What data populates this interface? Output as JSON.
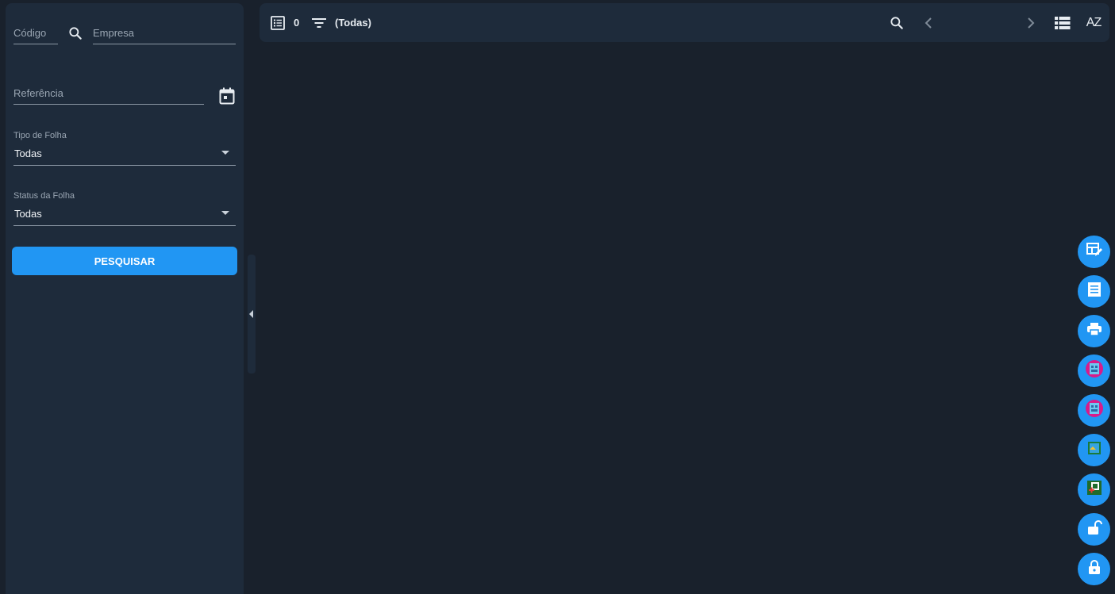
{
  "filters": {
    "codigo_placeholder": "Código",
    "empresa_placeholder": "Empresa",
    "referencia_placeholder": "Referência",
    "tipo_folha": {
      "label": "Tipo de Folha",
      "value": "Todas"
    },
    "status_folha": {
      "label": "Status da Folha",
      "value": "Todas"
    },
    "search_button": "PESQUISAR"
  },
  "toolbar": {
    "count": "0",
    "filter_text": "(Todas)",
    "sort_label": "AZ"
  },
  "fab_icons": [
    "table-edit-icon",
    "document-list-icon",
    "print-icon",
    "app-icon-1",
    "app-icon-2",
    "app-icon-3",
    "app-icon-4",
    "unlock-icon",
    "lock-icon"
  ],
  "colors": {
    "background": "#19212c",
    "panel": "#1e2b3b",
    "accent": "#2196f3"
  }
}
